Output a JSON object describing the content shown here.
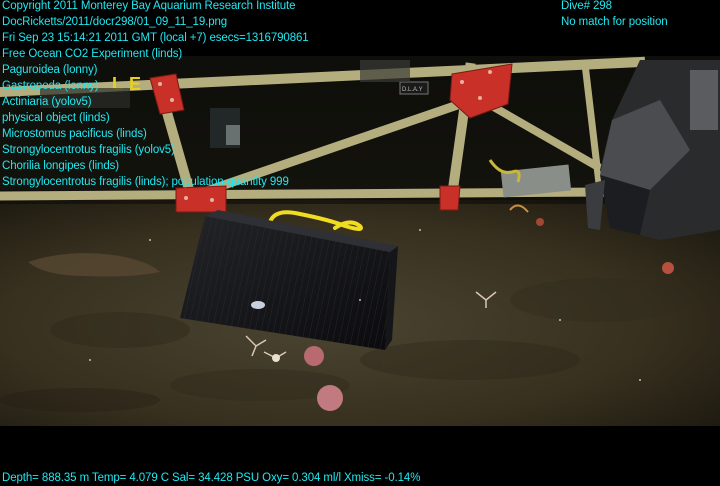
{
  "overlay_left": [
    "Copyright 2011 Monterey Bay Aquarium Research Institute",
    "DocRicketts/2011/docr298/01_09_11_19.png",
    "Fri Sep 23 15:14:21 2011 GMT (local +7)  esecs=1316790861",
    "Free Ocean CO2 Experiment (linds)",
    "Paguroidea (lonny)",
    "Gastropoda (lonny)",
    "Actiniaria (yolov5)",
    "physical object (linds)",
    "Microstomus pacificus (linds)",
    "Strongylocentrotus fragilis (yolov5)",
    "Chorilia longipes (linds)",
    "Strongylocentrotus fragilis (linds); population-quantity 999"
  ],
  "overlay_right": [
    "Dive# 298",
    "No match for position"
  ],
  "overlay_bottom": "Depth= 888.35 m  Temp= 4.079 C  Sal= 34.428 PSU  Oxy= 0.304 ml/l  Xmiss= -0.14%",
  "scene_text": {
    "sign_letters": "LE",
    "frame_plate": "D.L.A.Y"
  },
  "colors": {
    "overlay_text": "#20e8f0",
    "frame_beige": "#b4ad7e",
    "red_plate": "#c83028",
    "yellow_rope": "#f0dc20",
    "seafloor": "#3b3526"
  }
}
